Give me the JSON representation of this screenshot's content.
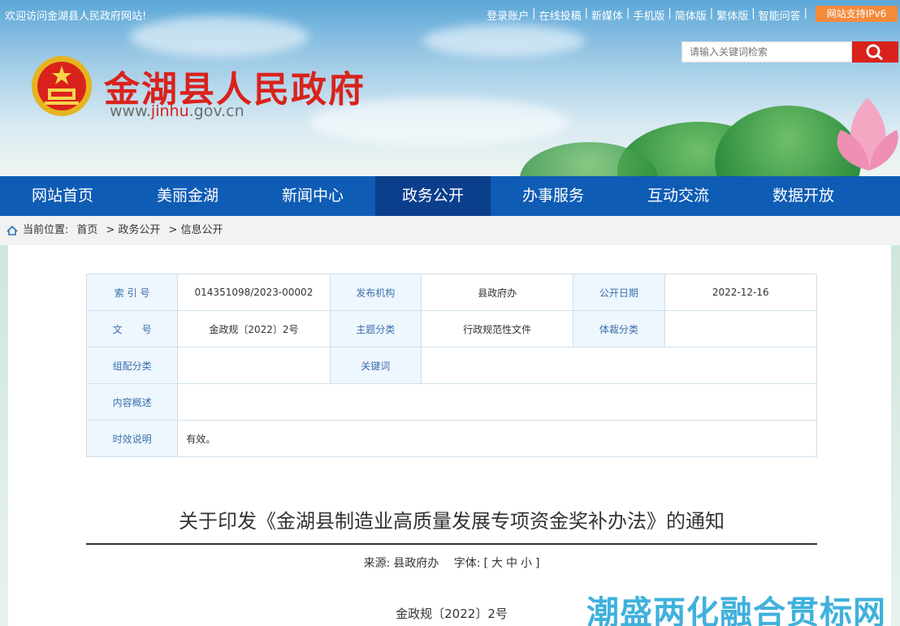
{
  "top_bar": {
    "welcome": "欢迎访问金湖县人民政府网站!",
    "links": [
      "登录账户",
      "在线投稿",
      "新媒体",
      "手机版",
      "简体版",
      "繁体版",
      "智能问答"
    ],
    "ipv6_badge": "网站支持IPv6"
  },
  "search": {
    "placeholder": "请输入关键词检索"
  },
  "brand": {
    "site_name": "金湖县人民政府",
    "url_prefix": "www.",
    "url_highlight": "jinhu",
    "url_suffix": ".gov.cn"
  },
  "nav": {
    "items": [
      "网站首页",
      "美丽金湖",
      "新闻中心",
      "政务公开",
      "办事服务",
      "互动交流",
      "数据开放"
    ],
    "active": "政务公开"
  },
  "breadcrumb": {
    "label": "当前位置:",
    "items": [
      "首页",
      "> 政务公开",
      "> 信息公开"
    ]
  },
  "meta": {
    "index_label": "索 引 号",
    "index_value": "014351098/2023-00002",
    "publisher_label": "发布机构",
    "publisher_value": "县政府办",
    "date_label": "公开日期",
    "date_value": "2022-12-16",
    "docno_label": "文　　号",
    "docno_value": "金政规〔2022〕2号",
    "topic_label": "主题分类",
    "topic_value": "行政规范性文件",
    "genre_label": "体裁分类",
    "genre_value": "",
    "group_label": "组配分类",
    "group_value": "",
    "keyword_label": "关键词",
    "keyword_value": "",
    "summary_label": "内容概述",
    "summary_value": "",
    "validity_label": "时效说明",
    "validity_value": "有效。"
  },
  "article": {
    "title": "关于印发《金湖县制造业高质量发展专项资金奖补办法》的通知",
    "source_label": "来源:",
    "source_value": "县政府办",
    "fontsize_label": "字体:",
    "fontsize_open": "[",
    "fontsize_large": "大",
    "fontsize_medium": "中",
    "fontsize_small": "小",
    "fontsize_close": "]",
    "doc_number": "金政规〔2022〕2号"
  },
  "watermark": "潮盛两化融合贯标网",
  "colors": {
    "brand_red": "#d9221c",
    "nav_blue": "#0f5cb5",
    "nav_active": "#0b3f8c",
    "ipv6_orange": "#f58a3b"
  }
}
